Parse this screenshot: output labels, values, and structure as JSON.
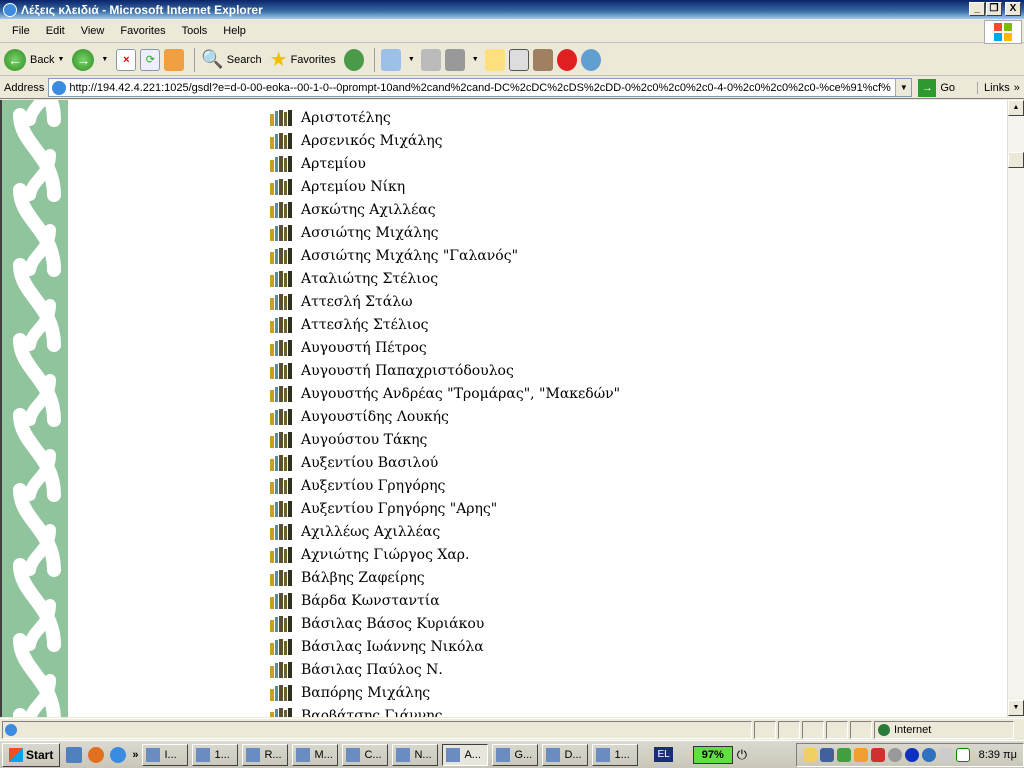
{
  "window": {
    "title": "Λέξεις κλειδιά - Microsoft Internet Explorer"
  },
  "menu": [
    "File",
    "Edit",
    "View",
    "Favorites",
    "Tools",
    "Help"
  ],
  "toolbar": {
    "back": "Back",
    "search": "Search",
    "favorites": "Favorites"
  },
  "address": {
    "label": "Address",
    "url": "http://194.42.4.221:1025/gsdl?e=d-0-00-eoka--00-1-0--0prompt-10and%2cand%2cand-DC%2cDC%2cDS%2cDD-0%2c0%2c0%2c0-4-0%2c0%2c0%2c0-%ce%91%cf%",
    "go": "Go",
    "links": "Links"
  },
  "list": [
    "Αριστοτέλης",
    "Αρσενικός Μιχάλης",
    "Αρτεμίου",
    "Αρτεμίου Νίκη",
    "Ασκώτης Αχιλλέας",
    "Ασσιώτης Μιχάλης",
    "Ασσιώτης Μιχάλης \"Γαλανός\"",
    "Αταλιώτης Στέλιος",
    "Αττεσλή Στάλω",
    "Αττεσλής Στέλιος",
    "Αυγουστή Πέτρος",
    "Αυγουστή Παπαχριστόδουλος",
    "Αυγουστής Ανδρέας \"Τρομάρας\", \"Μακεδών\"",
    "Αυγουστίδης Λουκής",
    "Αυγούστου Τάκης",
    "Αυξεντίου Βασιλού",
    "Αυξεντίου Γρηγόρης",
    "Αυξεντίου Γρηγόρης \"Αρης\"",
    "Αχιλλέως Αχιλλέας",
    "Αχνιώτης Γιώργος Χαρ.",
    "Βάλβης Ζαφείρης",
    "Βάρδα Κωνσταντία",
    "Βάσιλας Βάσος Κυριάκου",
    "Βάσιλας Ιωάννης Νικόλα",
    "Βάσιλας Παύλος Ν.",
    "Βαπόρης Μιχάλης",
    "Βαρβάτσης Γιάννης"
  ],
  "status": {
    "zone": "Internet"
  },
  "taskbar": {
    "start": "Start",
    "tasks": [
      "I...",
      "1...",
      "R...",
      "M...",
      "C...",
      "N...",
      "A...",
      "G...",
      "D...",
      "1..."
    ],
    "active_task": 6,
    "language": "EL",
    "battery": "97%",
    "clock": "8:39 πμ"
  },
  "colors": {
    "braid_green": "#8fc49d",
    "titlebar": "#0a246a"
  }
}
